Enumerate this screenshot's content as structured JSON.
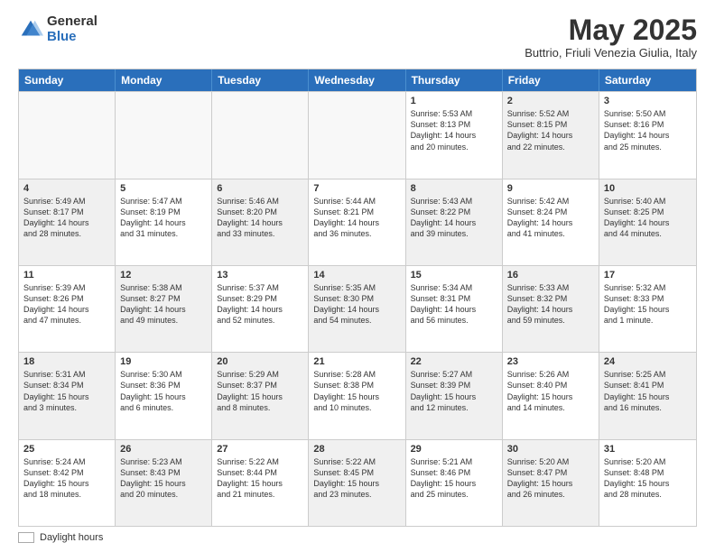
{
  "logo": {
    "general": "General",
    "blue": "Blue"
  },
  "title": "May 2025",
  "location": "Buttrio, Friuli Venezia Giulia, Italy",
  "days_of_week": [
    "Sunday",
    "Monday",
    "Tuesday",
    "Wednesday",
    "Thursday",
    "Friday",
    "Saturday"
  ],
  "legend_label": "Daylight hours",
  "weeks": [
    [
      {
        "day": "",
        "text": "",
        "empty": true
      },
      {
        "day": "",
        "text": "",
        "empty": true
      },
      {
        "day": "",
        "text": "",
        "empty": true
      },
      {
        "day": "",
        "text": "",
        "empty": true
      },
      {
        "day": "1",
        "text": "Sunrise: 5:53 AM\nSunset: 8:13 PM\nDaylight: 14 hours\nand 20 minutes."
      },
      {
        "day": "2",
        "text": "Sunrise: 5:52 AM\nSunset: 8:15 PM\nDaylight: 14 hours\nand 22 minutes.",
        "shaded": true
      },
      {
        "day": "3",
        "text": "Sunrise: 5:50 AM\nSunset: 8:16 PM\nDaylight: 14 hours\nand 25 minutes."
      }
    ],
    [
      {
        "day": "4",
        "text": "Sunrise: 5:49 AM\nSunset: 8:17 PM\nDaylight: 14 hours\nand 28 minutes.",
        "shaded": true
      },
      {
        "day": "5",
        "text": "Sunrise: 5:47 AM\nSunset: 8:19 PM\nDaylight: 14 hours\nand 31 minutes."
      },
      {
        "day": "6",
        "text": "Sunrise: 5:46 AM\nSunset: 8:20 PM\nDaylight: 14 hours\nand 33 minutes.",
        "shaded": true
      },
      {
        "day": "7",
        "text": "Sunrise: 5:44 AM\nSunset: 8:21 PM\nDaylight: 14 hours\nand 36 minutes."
      },
      {
        "day": "8",
        "text": "Sunrise: 5:43 AM\nSunset: 8:22 PM\nDaylight: 14 hours\nand 39 minutes.",
        "shaded": true
      },
      {
        "day": "9",
        "text": "Sunrise: 5:42 AM\nSunset: 8:24 PM\nDaylight: 14 hours\nand 41 minutes."
      },
      {
        "day": "10",
        "text": "Sunrise: 5:40 AM\nSunset: 8:25 PM\nDaylight: 14 hours\nand 44 minutes.",
        "shaded": true
      }
    ],
    [
      {
        "day": "11",
        "text": "Sunrise: 5:39 AM\nSunset: 8:26 PM\nDaylight: 14 hours\nand 47 minutes."
      },
      {
        "day": "12",
        "text": "Sunrise: 5:38 AM\nSunset: 8:27 PM\nDaylight: 14 hours\nand 49 minutes.",
        "shaded": true
      },
      {
        "day": "13",
        "text": "Sunrise: 5:37 AM\nSunset: 8:29 PM\nDaylight: 14 hours\nand 52 minutes."
      },
      {
        "day": "14",
        "text": "Sunrise: 5:35 AM\nSunset: 8:30 PM\nDaylight: 14 hours\nand 54 minutes.",
        "shaded": true
      },
      {
        "day": "15",
        "text": "Sunrise: 5:34 AM\nSunset: 8:31 PM\nDaylight: 14 hours\nand 56 minutes."
      },
      {
        "day": "16",
        "text": "Sunrise: 5:33 AM\nSunset: 8:32 PM\nDaylight: 14 hours\nand 59 minutes.",
        "shaded": true
      },
      {
        "day": "17",
        "text": "Sunrise: 5:32 AM\nSunset: 8:33 PM\nDaylight: 15 hours\nand 1 minute."
      }
    ],
    [
      {
        "day": "18",
        "text": "Sunrise: 5:31 AM\nSunset: 8:34 PM\nDaylight: 15 hours\nand 3 minutes.",
        "shaded": true
      },
      {
        "day": "19",
        "text": "Sunrise: 5:30 AM\nSunset: 8:36 PM\nDaylight: 15 hours\nand 6 minutes."
      },
      {
        "day": "20",
        "text": "Sunrise: 5:29 AM\nSunset: 8:37 PM\nDaylight: 15 hours\nand 8 minutes.",
        "shaded": true
      },
      {
        "day": "21",
        "text": "Sunrise: 5:28 AM\nSunset: 8:38 PM\nDaylight: 15 hours\nand 10 minutes."
      },
      {
        "day": "22",
        "text": "Sunrise: 5:27 AM\nSunset: 8:39 PM\nDaylight: 15 hours\nand 12 minutes.",
        "shaded": true
      },
      {
        "day": "23",
        "text": "Sunrise: 5:26 AM\nSunset: 8:40 PM\nDaylight: 15 hours\nand 14 minutes."
      },
      {
        "day": "24",
        "text": "Sunrise: 5:25 AM\nSunset: 8:41 PM\nDaylight: 15 hours\nand 16 minutes.",
        "shaded": true
      }
    ],
    [
      {
        "day": "25",
        "text": "Sunrise: 5:24 AM\nSunset: 8:42 PM\nDaylight: 15 hours\nand 18 minutes."
      },
      {
        "day": "26",
        "text": "Sunrise: 5:23 AM\nSunset: 8:43 PM\nDaylight: 15 hours\nand 20 minutes.",
        "shaded": true
      },
      {
        "day": "27",
        "text": "Sunrise: 5:22 AM\nSunset: 8:44 PM\nDaylight: 15 hours\nand 21 minutes."
      },
      {
        "day": "28",
        "text": "Sunrise: 5:22 AM\nSunset: 8:45 PM\nDaylight: 15 hours\nand 23 minutes.",
        "shaded": true
      },
      {
        "day": "29",
        "text": "Sunrise: 5:21 AM\nSunset: 8:46 PM\nDaylight: 15 hours\nand 25 minutes."
      },
      {
        "day": "30",
        "text": "Sunrise: 5:20 AM\nSunset: 8:47 PM\nDaylight: 15 hours\nand 26 minutes.",
        "shaded": true
      },
      {
        "day": "31",
        "text": "Sunrise: 5:20 AM\nSunset: 8:48 PM\nDaylight: 15 hours\nand 28 minutes."
      }
    ]
  ]
}
